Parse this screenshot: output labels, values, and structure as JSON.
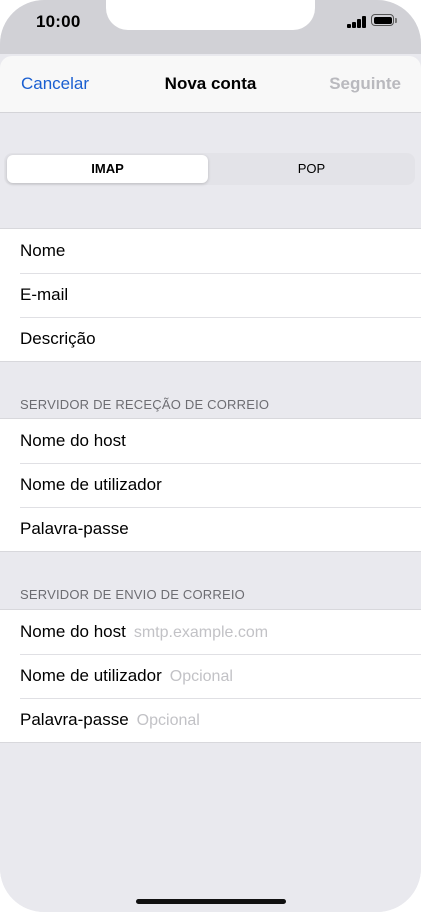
{
  "status_bar": {
    "time": "10:00",
    "signal_icon": "signal-bars-icon",
    "battery_icon": "battery-full-icon"
  },
  "nav": {
    "cancel_label": "Cancelar",
    "title": "Nova conta",
    "next_label": "Seguinte"
  },
  "segmented": {
    "options": [
      "IMAP",
      "POP"
    ],
    "selected": "IMAP"
  },
  "account": {
    "rows": [
      {
        "label": "Nome"
      },
      {
        "label": "E-mail"
      },
      {
        "label": "Descrição"
      }
    ]
  },
  "incoming": {
    "header": "SERVIDOR DE RECEÇÃO DE CORREIO",
    "rows": [
      {
        "label": "Nome do host"
      },
      {
        "label": "Nome de utilizador"
      },
      {
        "label": "Palavra-passe"
      }
    ]
  },
  "outgoing": {
    "header": "SERVIDOR DE ENVIO DE CORREIO",
    "rows": [
      {
        "label": "Nome do host",
        "placeholder": "smtp.example.com"
      },
      {
        "label": "Nome de utilizador",
        "placeholder": "Opcional"
      },
      {
        "label": "Palavra-passe",
        "placeholder": "Opcional"
      }
    ]
  },
  "colors": {
    "accent": "#1a5fd1",
    "disabled": "#b9b9be",
    "background": "#e9e9ee"
  }
}
